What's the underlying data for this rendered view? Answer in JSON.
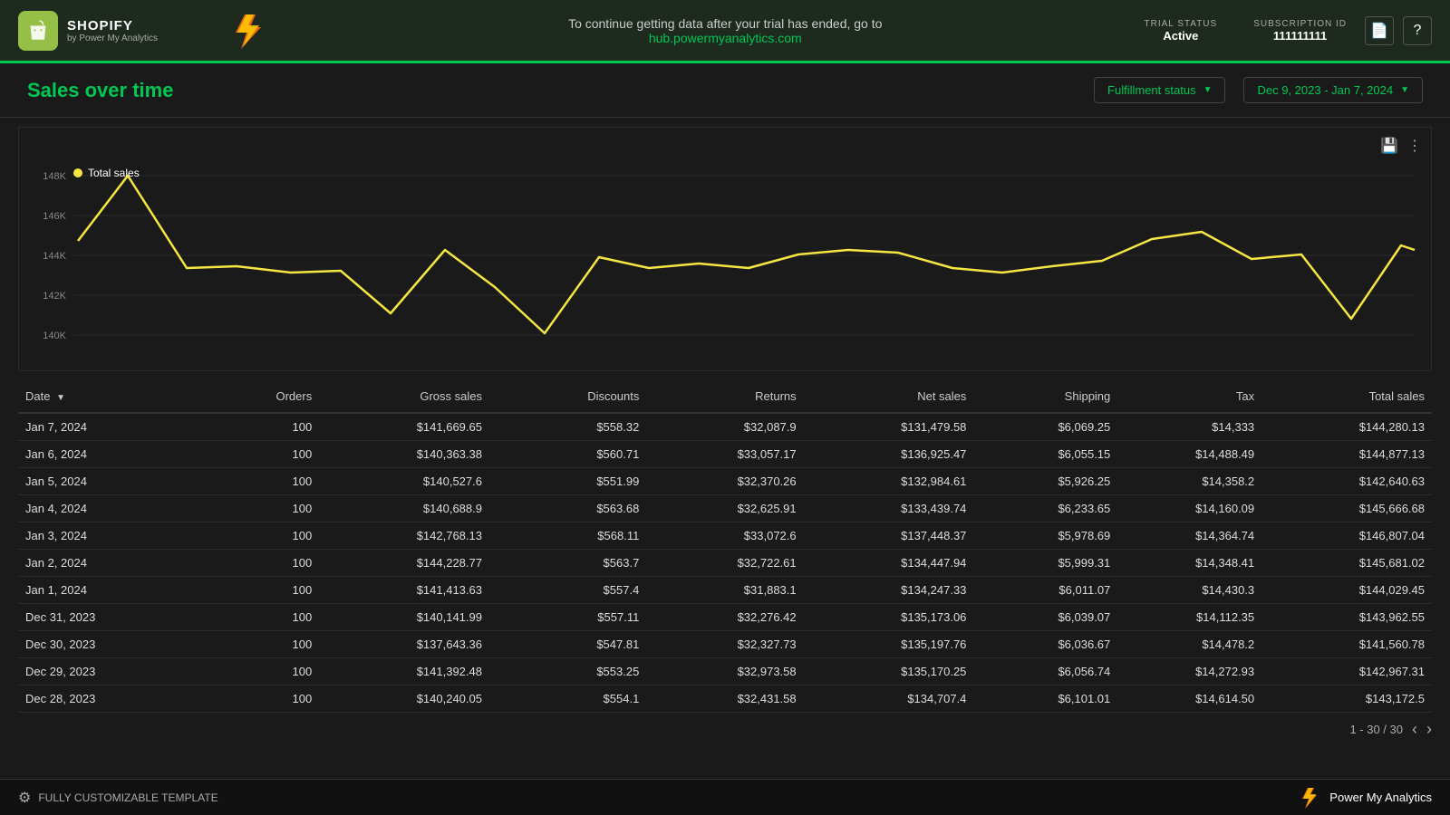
{
  "header": {
    "shopify_title": "SHOPIFY",
    "shopify_sub": "by Power My Analytics",
    "trial_banner_text": "To continue getting data after your trial has ended, go to",
    "trial_banner_link": "hub.powermyanalytics.com",
    "trial_status_label": "TRIAL STATUS",
    "trial_status_value": "Active",
    "subscription_label": "SUBSCRIPTION ID",
    "subscription_value": "111111111"
  },
  "toolbar": {
    "page_title": "Sales over time",
    "filter_label": "Fulfillment status",
    "date_range_label": "Dec 9, 2023 - Jan 7, 2024"
  },
  "chart": {
    "legend_label": "Total sales",
    "y_labels": [
      "148K",
      "146K",
      "144K",
      "142K",
      "140K"
    ]
  },
  "table": {
    "columns": [
      "Date",
      "Orders",
      "Gross sales",
      "Discounts",
      "Returns",
      "Net sales",
      "Shipping",
      "Tax",
      "Total sales"
    ],
    "rows": [
      [
        "Jan 7, 2024",
        "100",
        "$141,669.65",
        "$558.32",
        "$32,087.9",
        "$131,479.58",
        "$6,069.25",
        "$14,333",
        "$144,280.13"
      ],
      [
        "Jan 6, 2024",
        "100",
        "$140,363.38",
        "$560.71",
        "$33,057.17",
        "$136,925.47",
        "$6,055.15",
        "$14,488.49",
        "$144,877.13"
      ],
      [
        "Jan 5, 2024",
        "100",
        "$140,527.6",
        "$551.99",
        "$32,370.26",
        "$132,984.61",
        "$5,926.25",
        "$14,358.2",
        "$142,640.63"
      ],
      [
        "Jan 4, 2024",
        "100",
        "$140,688.9",
        "$563.68",
        "$32,625.91",
        "$133,439.74",
        "$6,233.65",
        "$14,160.09",
        "$145,666.68"
      ],
      [
        "Jan 3, 2024",
        "100",
        "$142,768.13",
        "$568.11",
        "$33,072.6",
        "$137,448.37",
        "$5,978.69",
        "$14,364.74",
        "$146,807.04"
      ],
      [
        "Jan 2, 2024",
        "100",
        "$144,228.77",
        "$563.7",
        "$32,722.61",
        "$134,447.94",
        "$5,999.31",
        "$14,348.41",
        "$145,681.02"
      ],
      [
        "Jan 1, 2024",
        "100",
        "$141,413.63",
        "$557.4",
        "$31,883.1",
        "$134,247.33",
        "$6,011.07",
        "$14,430.3",
        "$144,029.45"
      ],
      [
        "Dec 31, 2023",
        "100",
        "$140,141.99",
        "$557.11",
        "$32,276.42",
        "$135,173.06",
        "$6,039.07",
        "$14,112.35",
        "$143,962.55"
      ],
      [
        "Dec 30, 2023",
        "100",
        "$137,643.36",
        "$547.81",
        "$32,327.73",
        "$135,197.76",
        "$6,036.67",
        "$14,478.2",
        "$141,560.78"
      ],
      [
        "Dec 29, 2023",
        "100",
        "$141,392.48",
        "$553.25",
        "$32,973.58",
        "$135,170.25",
        "$6,056.74",
        "$14,272.93",
        "$142,967.31"
      ],
      [
        "Dec 28, 2023",
        "100",
        "$140,240.05",
        "$554.1",
        "$32,431.58",
        "$134,707.4",
        "$6,101.01",
        "$14,614.50",
        "$143,172.5"
      ]
    ],
    "pagination": "1 - 30 / 30"
  },
  "footer": {
    "template_label": "FULLY CUSTOMIZABLE TEMPLATE",
    "brand_label": "Power My Analytics"
  }
}
